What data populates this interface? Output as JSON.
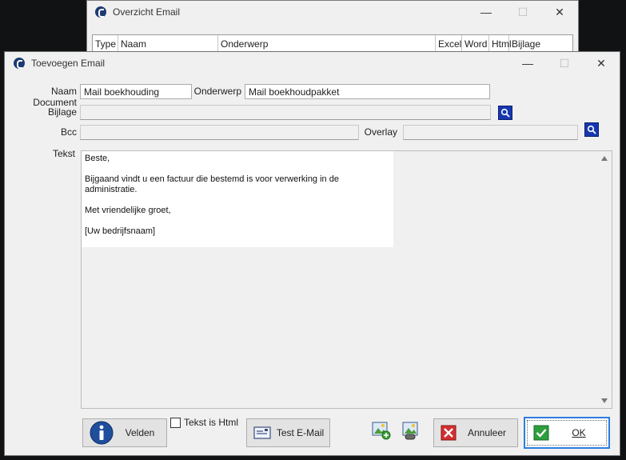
{
  "bg_window": {
    "title": "Overzicht Email",
    "columns": [
      "Type",
      "Naam",
      "Onderwerp",
      "Excel",
      "Word",
      "Html",
      "Bijlage"
    ]
  },
  "dialog": {
    "title": "Toevoegen Email",
    "naam_document": {
      "label": "Naam Document",
      "value": "Mail boekhouding"
    },
    "onderwerp": {
      "label": "Onderwerp",
      "value": "Mail boekhoudpakket"
    },
    "bijlage": {
      "label": "Bijlage",
      "value": ""
    },
    "bcc": {
      "label": "Bcc",
      "value": ""
    },
    "overlay": {
      "label": "Overlay",
      "value": ""
    },
    "tekst": {
      "label": "Tekst",
      "lines": [
        "Beste,",
        "Bijgaand vindt u een factuur die bestemd is voor verwerking in de administratie.",
        "Met vriendelijke groet,",
        "[Uw bedrijfsnaam]"
      ]
    },
    "buttons": {
      "velden": "Velden",
      "tekst_is_html": "Tekst is Html",
      "test_email": "Test E-Mail",
      "annuleer": "Annuleer",
      "ok": "OK"
    }
  },
  "window_controls": {
    "minimize": "—",
    "maximize": "☐",
    "close": "✕"
  },
  "colors": {
    "accent": "#2a7de1",
    "search": "#1737b0",
    "cancel": "#d32f2f",
    "ok_check": "#2e9e3e"
  }
}
